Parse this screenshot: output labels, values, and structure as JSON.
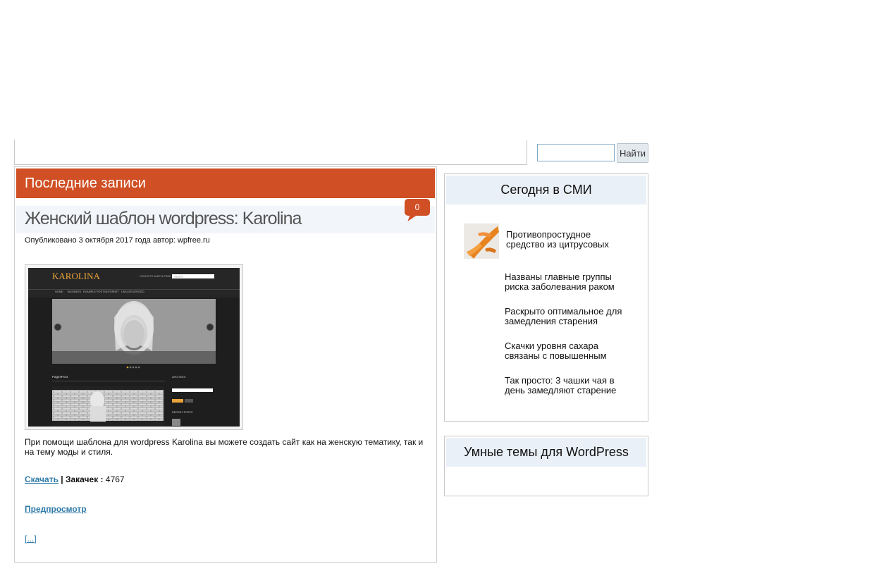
{
  "search": {
    "input_value": "",
    "button_label": "Найти"
  },
  "main": {
    "section_title": "Последние записи",
    "post": {
      "title": "Женский шаблон wordpress: Karolina",
      "comment_count": "0",
      "meta": "Опубликовано 3 октября 2017 года автор: wpfree.ru",
      "thumbnail_text": {
        "logo": "KAROLINA",
        "nav": [
          "HOME",
          "BUSINESS",
          "EXAMPLE POSTS",
          "INTERNET",
          "UNCATEGORIZED"
        ],
        "top_links": "CONTACTS    SAMPLE PAGE",
        "search_placeholder": "Search",
        "sidebar_heading_archives": "ARCHIVES",
        "sidebar_heading_recent": "RECENT POSTS",
        "post_title": "Page4Post"
      },
      "excerpt": "При помощи шаблона для wordpress Karolina вы можете создать сайт как на женскую тематику, так и на тему моды и стиля.",
      "download_label": "Скачать",
      "downloads_label": "| Закачек :",
      "downloads_count": "4767",
      "preview_label": "Предпросмотр",
      "more_label": "[...]"
    }
  },
  "sidebar": {
    "news_widget": {
      "title": "Сегодня в СМИ",
      "items": [
        {
          "text": "Противопростудное средство из цитрусовых",
          "has_image": true
        },
        {
          "text": "Названы главные группы риска заболевания раком"
        },
        {
          "text": "Раскрыто оптимальное для замедления старения"
        },
        {
          "text": "Скачки уровня сахара связаны с повышенным"
        },
        {
          "text": "Так просто: 3 чашки чая в день замедляют старение"
        }
      ]
    },
    "themes_widget": {
      "title": "Умные темы для WordPress"
    }
  },
  "colors": {
    "accent": "#d04f24",
    "link": "#2f7aa8",
    "widget_header_bg": "#eaf0f7",
    "title_bar_bg": "#f2f5fa"
  }
}
